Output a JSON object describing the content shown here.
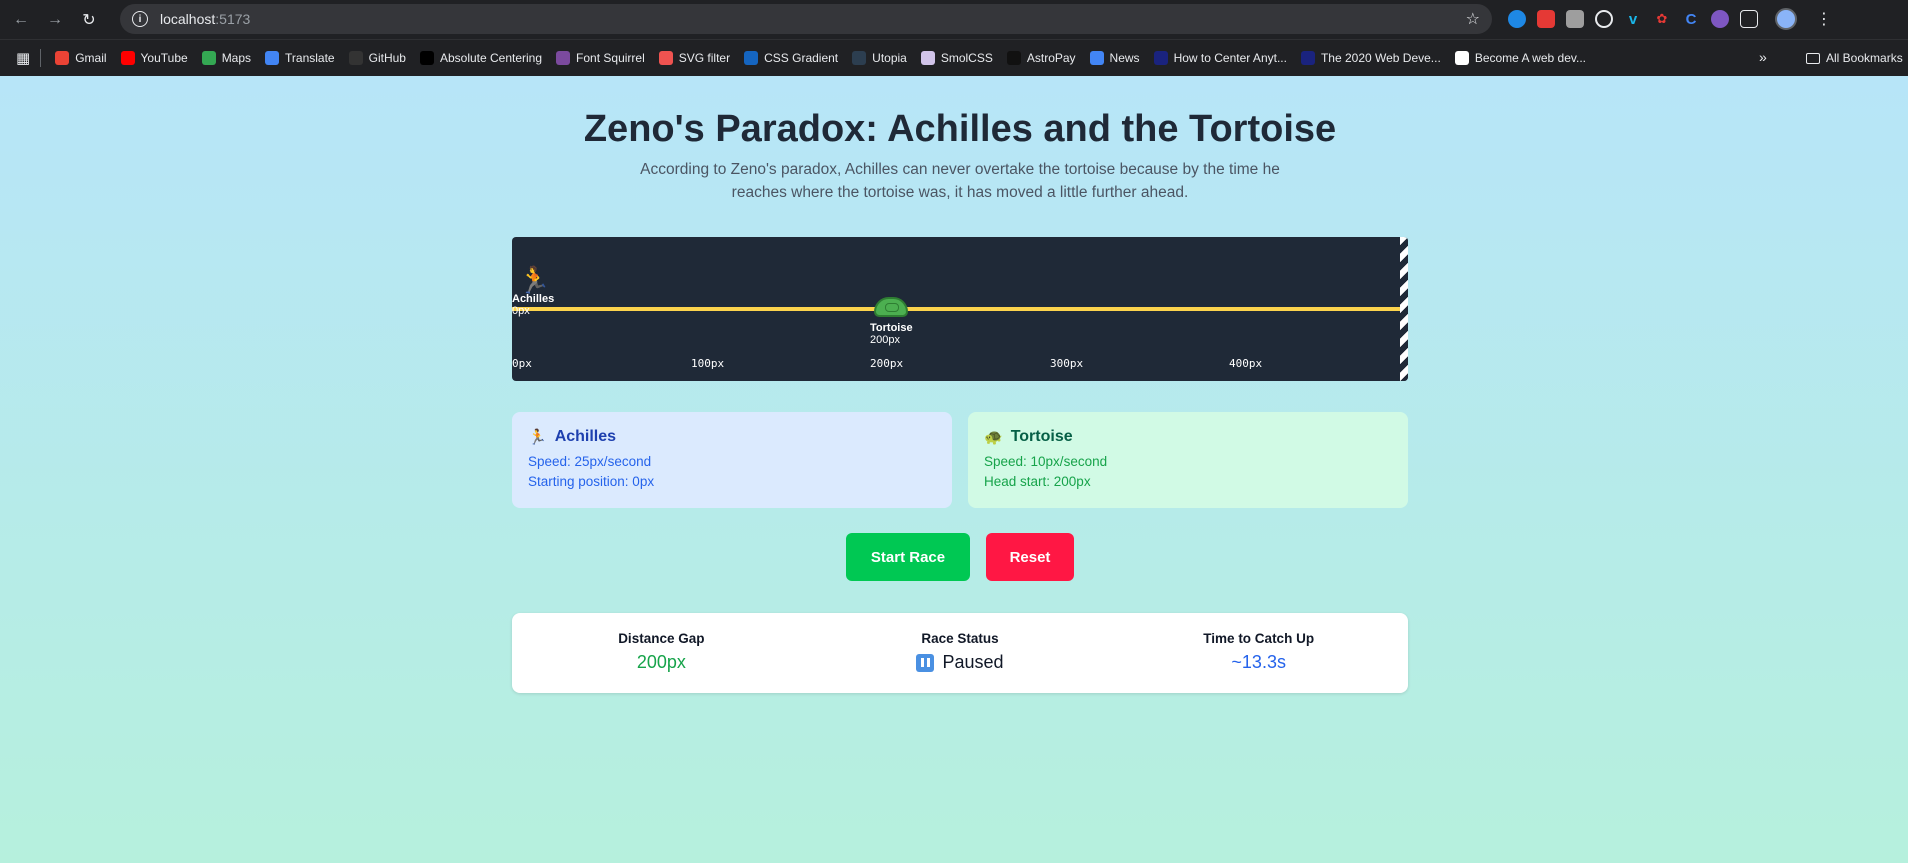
{
  "browser": {
    "url_host": "localhost",
    "url_port": ":5173",
    "bookmarks": [
      {
        "label": "Gmail",
        "icon": "gmail-icon",
        "color": "#ea4335"
      },
      {
        "label": "YouTube",
        "icon": "youtube-icon",
        "color": "#ff0000"
      },
      {
        "label": "Maps",
        "icon": "maps-icon",
        "color": "#34a853"
      },
      {
        "label": "Translate",
        "icon": "translate-icon",
        "color": "#4285f4"
      },
      {
        "label": "GitHub",
        "icon": "github-icon",
        "color": "#333333"
      },
      {
        "label": "Absolute Centering",
        "icon": "medium-icon",
        "color": "#000000"
      },
      {
        "label": "Font Squirrel",
        "icon": "squirrel-icon",
        "color": "#7b4a9e"
      },
      {
        "label": "SVG filter",
        "icon": "asterisk-icon",
        "color": "#ef5350"
      },
      {
        "label": "CSS Gradient",
        "icon": "gradient-icon",
        "color": "#1565c0"
      },
      {
        "label": "Utopia",
        "icon": "utopia-icon",
        "color": "#2c3e50"
      },
      {
        "label": "SmolCSS",
        "icon": "smolcss-icon",
        "color": "#d1c4e9"
      },
      {
        "label": "AstroPay",
        "icon": "astropay-icon",
        "color": "#111111"
      },
      {
        "label": "News",
        "icon": "news-icon",
        "color": "#4285f4"
      },
      {
        "label": "How to Center Anyt...",
        "icon": "lambda-icon",
        "color": "#1a237e"
      },
      {
        "label": "The 2020 Web Deve...",
        "icon": "lambda-icon",
        "color": "#1a237e"
      },
      {
        "label": "Become A web dev...",
        "icon": "cf-icon",
        "color": "#ffffff"
      }
    ],
    "all_bookmarks": "All Bookmarks"
  },
  "page": {
    "title": "Zeno's Paradox: Achilles and the Tortoise",
    "description": "According to Zeno's paradox, Achilles can never overtake the tortoise because by the time he reaches where the tortoise was, it has moved a little further ahead."
  },
  "track": {
    "achilles": {
      "emoji": "🏃",
      "name": "Achilles",
      "position": "0px"
    },
    "tortoise": {
      "emoji": "🐢",
      "name": "Tortoise",
      "position": "200px"
    },
    "ticks": [
      "0px",
      "100px",
      "200px",
      "300px",
      "400px"
    ]
  },
  "achilles_card": {
    "icon": "runner-icon",
    "title": "Achilles",
    "speed": "Speed: 25px/second",
    "start": "Starting position: 0px"
  },
  "tortoise_card": {
    "icon": "turtle-icon",
    "title": "Tortoise",
    "speed": "Speed: 10px/second",
    "start": "Head start: 200px"
  },
  "buttons": {
    "start": "Start Race",
    "reset": "Reset"
  },
  "stats": {
    "gap_label": "Distance Gap",
    "gap_value": "200px",
    "status_label": "Race Status",
    "status_value": "Paused",
    "time_label": "Time to Catch Up",
    "time_value": "~13.3s"
  },
  "colors": {
    "start_button": "#00c853",
    "reset_button": "#ff1744",
    "track": "#1f2937",
    "lane": "#fcd34d"
  }
}
